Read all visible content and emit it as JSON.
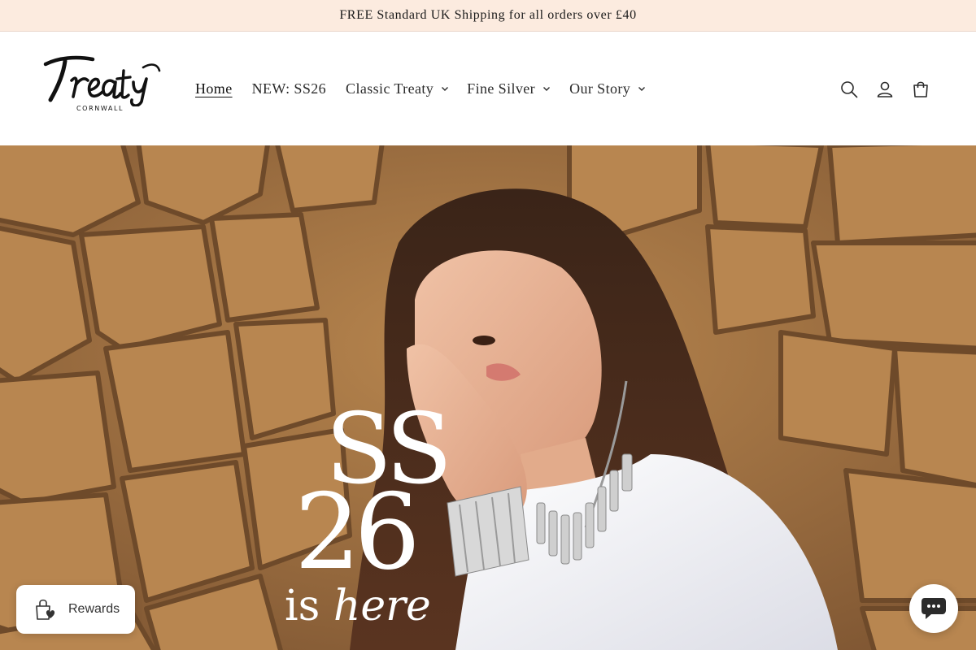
{
  "announcement": {
    "text": "FREE Standard UK Shipping for all orders over £40"
  },
  "brand": {
    "logo_script": "Treaty",
    "logo_sub": "CORNWALL"
  },
  "nav": {
    "items": [
      {
        "label": "Home",
        "active": true,
        "has_dropdown": false
      },
      {
        "label": "NEW: SS26",
        "active": false,
        "has_dropdown": false
      },
      {
        "label": "Classic Treaty",
        "active": false,
        "has_dropdown": true
      },
      {
        "label": "Fine Silver",
        "active": false,
        "has_dropdown": true
      },
      {
        "label": "Our Story",
        "active": false,
        "has_dropdown": true
      }
    ]
  },
  "header_icons": [
    "search-icon",
    "account-icon",
    "cart-icon"
  ],
  "hero": {
    "line1": "SS",
    "line2": "26",
    "line3_plain": "is ",
    "line3_italic": "here"
  },
  "rewards": {
    "label": "Rewards",
    "icon": "gift-bag-icon"
  },
  "chat": {
    "icon": "chat-bubble-icon",
    "color": "#2b2b2b"
  },
  "colors": {
    "announcement_bg": "#fcebdf",
    "hero_wall": "#a77846",
    "text_dark": "#1f1f1f"
  }
}
